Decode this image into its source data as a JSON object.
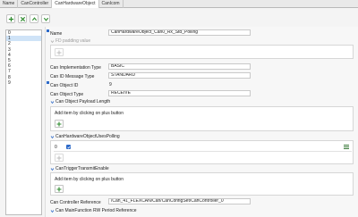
{
  "tabs": [
    "Name",
    "CanController",
    "CanHardwareObject",
    "CanIcom"
  ],
  "active_tab": 2,
  "list": {
    "items": [
      "0",
      "1",
      "2",
      "3",
      "4",
      "5",
      "6",
      "7",
      "8",
      "9"
    ],
    "selected_index": 1
  },
  "form": {
    "name_label": "Name",
    "name_value": "CanHardwareObject_Can0_Rx_Std_Polling",
    "fd_padding_label": "FD padding value",
    "impl_type_label": "Can Implementation Type",
    "impl_type_value": "BASIC",
    "id_msg_type_label": "Can ID Message Type",
    "id_msg_type_value": "STANDARD",
    "object_id_label": "Can Object ID",
    "object_id_value": "9",
    "object_type_label": "Can Object Type",
    "object_type_value": "RECEIVE",
    "payload_length_label": "Can Object Payload Length",
    "payload_hint": "Add item by clicking on plus button",
    "uses_polling_label": "CanHardwareObjectUsesPolling",
    "uses_polling_row_index": "0",
    "trigger_transmit_label": "CanTriggerTransmitEnable",
    "trigger_hint": "Add item by clicking on plus button",
    "controller_ref_label": "Can Controller Reference",
    "controller_ref_value": "/Can_41_FLEXCAN/Can/CanConfigSet/CanController_0",
    "mainfunction_label": "Can MainFunction RW Period Reference"
  },
  "colors": {
    "accent": "#2d6ac9",
    "plus_green": "#2e8b2e",
    "selection": "#cfe3f7"
  },
  "icons": {
    "add": "plus-icon",
    "delete": "close-icon",
    "up": "chevron-up-icon",
    "down": "chevron-down-icon",
    "menu": "hamburger-icon"
  }
}
